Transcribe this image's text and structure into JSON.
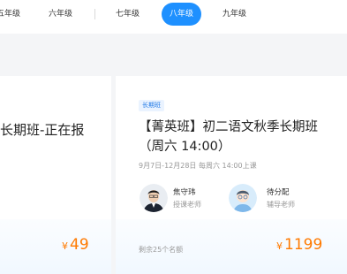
{
  "grades": {
    "items": [
      "五年级",
      "六年级",
      "七年级",
      "八年级",
      "九年级"
    ],
    "active": "八年级"
  },
  "cards": {
    "left": {
      "title": "长期班-正在报",
      "price_symbol": "¥",
      "price": "49"
    },
    "right": {
      "tag": "长期班",
      "title": "【菁英班】初二语文秋季长期班（周六 14:00）",
      "schedule": "9月7日-12月28日 每周六 14:00上课",
      "teacher": {
        "name": "焦守玮",
        "role": "授课老师"
      },
      "tutor": {
        "name": "待分配",
        "role": "辅导老师"
      },
      "seats": "剩余25个名额",
      "price_symbol": "¥",
      "price": "1199"
    }
  },
  "colors": {
    "accent": "#1e90ff",
    "price": "#ff7a00",
    "tag_text": "#1e78e6",
    "tag_bg": "#eaf3ff"
  }
}
